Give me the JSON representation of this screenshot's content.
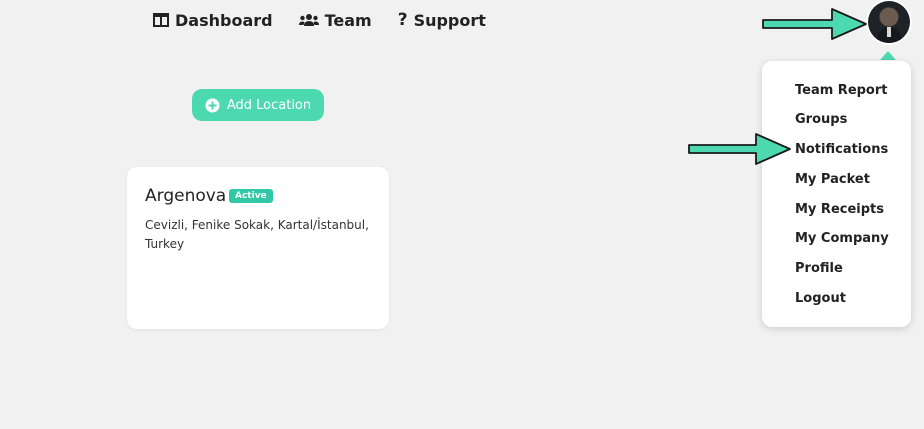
{
  "nav": [
    {
      "label": "Dashboard",
      "icon": "dashboard-icon"
    },
    {
      "label": "Team",
      "icon": "team-icon"
    },
    {
      "label": "Support",
      "icon": "question-icon"
    }
  ],
  "add_location": {
    "label": "Add Location",
    "icon": "plus-circle-icon"
  },
  "location_card": {
    "name": "Argenova",
    "status": "Active",
    "address": "Cevizli, Fenike Sokak, Kartal/İstanbul, Turkey"
  },
  "user_menu": {
    "items": [
      "Team Report",
      "Groups",
      "Notifications",
      "My Packet",
      "My Receipts",
      "My Company",
      "Profile",
      "Logout"
    ]
  },
  "colors": {
    "accent": "#4dd9b0",
    "badge": "#30c8a5",
    "background": "#f1f1f1"
  }
}
